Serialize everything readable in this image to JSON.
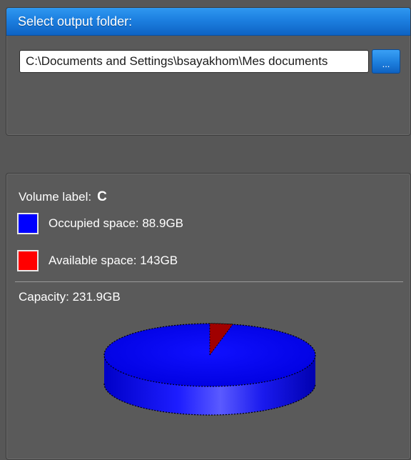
{
  "output_folder": {
    "title": "Select output folder:",
    "path_value": "C:\\Documents and Settings\\bsayakhom\\Mes documents",
    "browse_label": "..."
  },
  "volume": {
    "label_caption": "Volume label:",
    "label_value": "C",
    "occupied_text": "Occupied space: 88.9GB",
    "available_text": "Available space: 143GB",
    "capacity_text": "Capacity: 231.9GB",
    "colors": {
      "occupied": "#0000ff",
      "available": "#ff0000"
    }
  },
  "chart_data": {
    "type": "pie",
    "slices": [
      {
        "name": "Occupied space",
        "value": 88.9,
        "color": "#0000ff"
      },
      {
        "name": "Available space",
        "value": 143,
        "color": "#ff0000"
      }
    ]
  }
}
